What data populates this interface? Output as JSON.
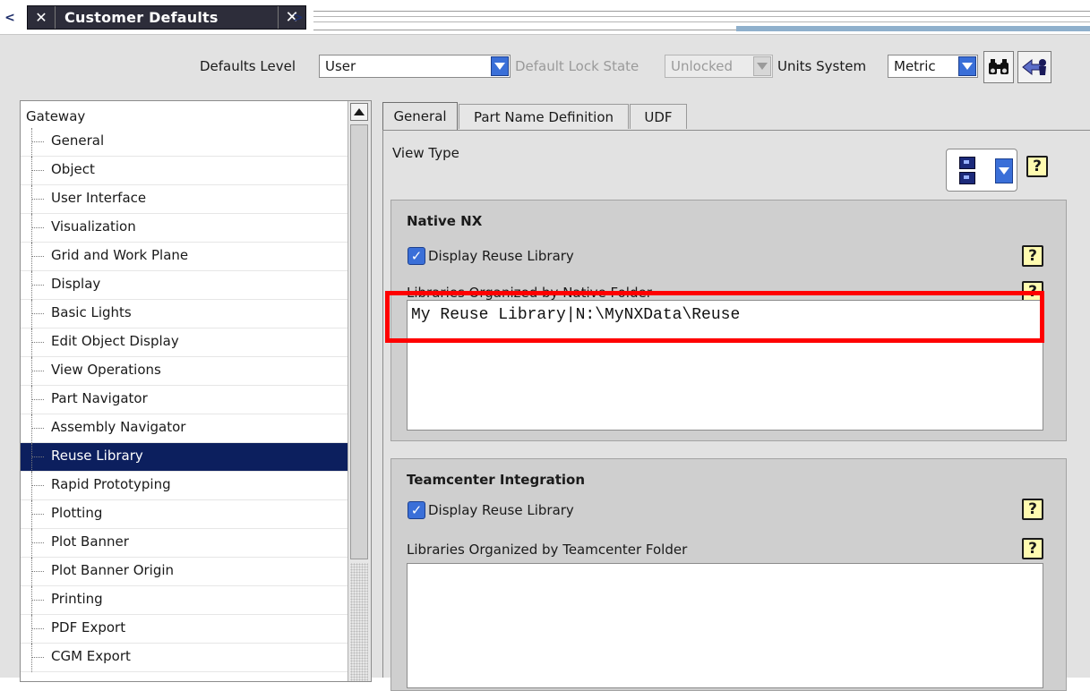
{
  "window": {
    "title": "Customer Defaults",
    "nav_prev": "<",
    "nav_next": ">",
    "pin_glyph": "✕",
    "close_glyph": "✕"
  },
  "toolbar": {
    "defaults_level_label": "Defaults Level",
    "defaults_level_value": "User",
    "lock_state_label": "Default Lock State",
    "lock_state_value": "Unlocked",
    "units_label": "Units System",
    "units_value": "Metric",
    "find_icon": "binoculars-icon",
    "back_icon": "arrow-back-icon"
  },
  "tree": {
    "root": "Gateway",
    "items": [
      {
        "label": "General"
      },
      {
        "label": "Object"
      },
      {
        "label": "User Interface"
      },
      {
        "label": "Visualization"
      },
      {
        "label": "Grid and Work Plane"
      },
      {
        "label": "Display"
      },
      {
        "label": "Basic Lights"
      },
      {
        "label": "Edit Object Display"
      },
      {
        "label": "View Operations"
      },
      {
        "label": "Part Navigator"
      },
      {
        "label": "Assembly Navigator"
      },
      {
        "label": "Reuse Library",
        "selected": true
      },
      {
        "label": "Rapid Prototyping"
      },
      {
        "label": "Plotting"
      },
      {
        "label": "Plot Banner"
      },
      {
        "label": "Plot Banner Origin"
      },
      {
        "label": "Printing"
      },
      {
        "label": "PDF Export"
      },
      {
        "label": "CGM Export"
      }
    ]
  },
  "tabs": [
    {
      "label": "General",
      "active": true
    },
    {
      "label": "Part Name Definition",
      "active": false
    },
    {
      "label": "UDF",
      "active": false
    }
  ],
  "content": {
    "view_type_label": "View Type",
    "help_glyph": "?",
    "native": {
      "title": "Native NX",
      "display_label": "Display Reuse Library",
      "libraries_label": "Libraries Organized by Native Folder",
      "libraries_value": "My Reuse Library|N:\\MyNXData\\Reuse"
    },
    "teamcenter": {
      "title": "Teamcenter Integration",
      "display_label": "Display Reuse Library",
      "libraries_label": "Libraries Organized by Teamcenter Folder",
      "libraries_value": ""
    },
    "check_glyph": "✓"
  },
  "colors": {
    "selection": "#0c1f5e",
    "accent": "#3a6fd8",
    "highlight_box": "#ff0000"
  }
}
